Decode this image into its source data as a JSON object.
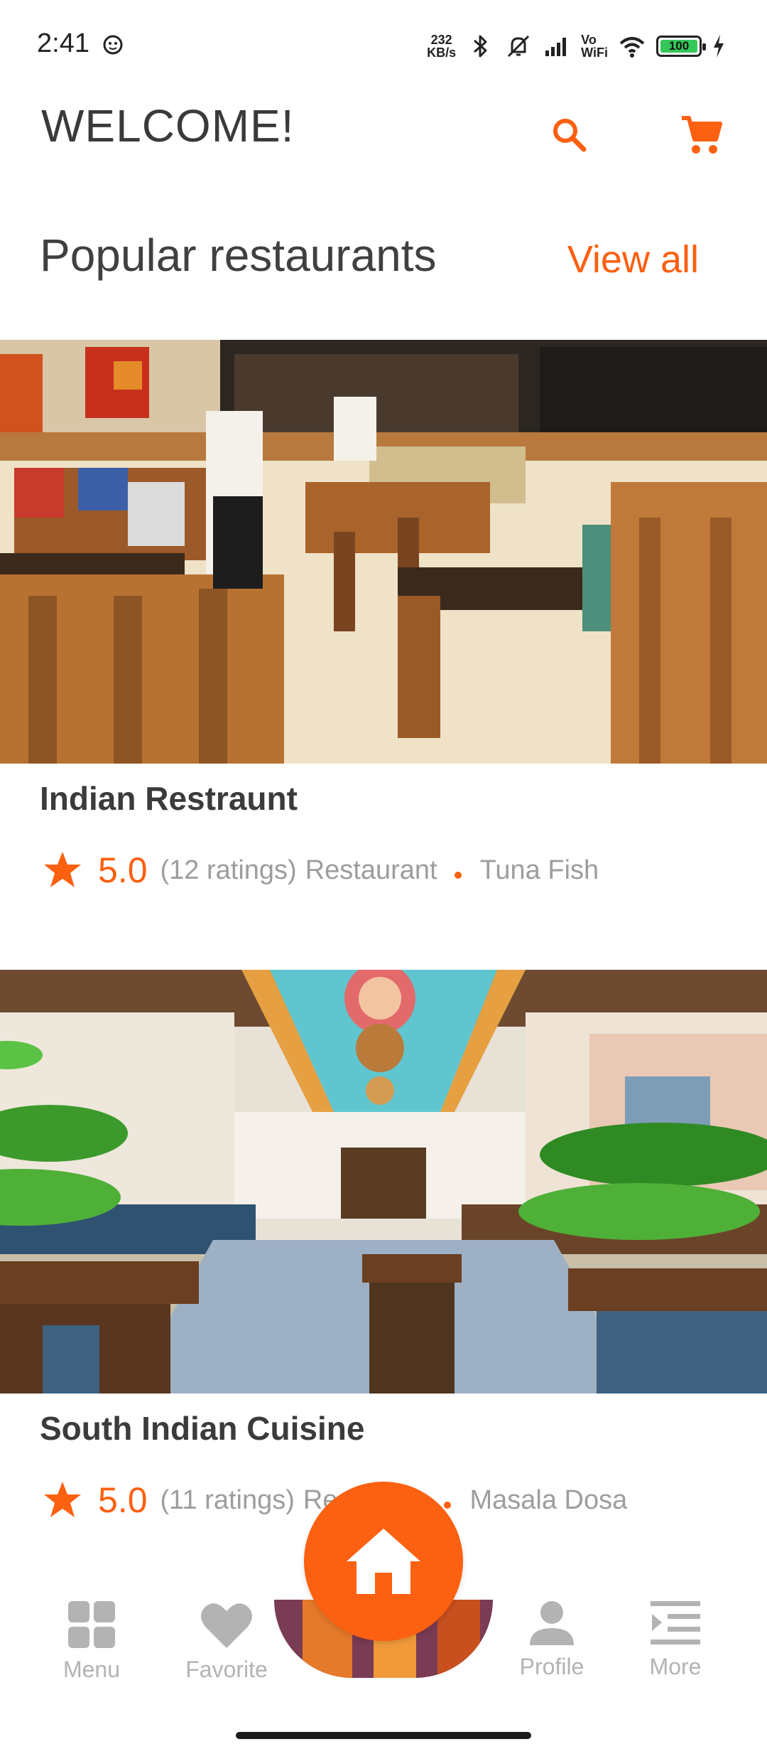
{
  "status_bar": {
    "time": "2:41",
    "net_speed_value": "232",
    "net_speed_unit": "KB/s",
    "vowifi_top": "Vo",
    "vowifi_bottom": "WiFi",
    "battery": "100"
  },
  "header": {
    "title": "WELCOME!",
    "search_icon": "search-icon",
    "cart_icon": "cart-icon"
  },
  "section": {
    "title": "Popular restaurants",
    "view_all": "View all"
  },
  "restaurants": [
    {
      "name": "Indian Restraunt",
      "rating": "5.0",
      "ratings_count": "(12 ratings)",
      "type": "Restaurant",
      "dish": "Tuna Fish"
    },
    {
      "name": "South Indian Cuisine",
      "rating": "5.0",
      "ratings_count": "(11 ratings)",
      "type": "Re",
      "dish": "Masala Dosa"
    }
  ],
  "bottom_nav": {
    "menu": "Menu",
    "favorite": "Favorite",
    "profile": "Profile",
    "more": "More"
  },
  "colors": {
    "accent": "#fc6011",
    "text_primary": "#3b3b3b",
    "text_secondary": "#9d9d9d",
    "nav_inactive": "#b3b3b3"
  }
}
